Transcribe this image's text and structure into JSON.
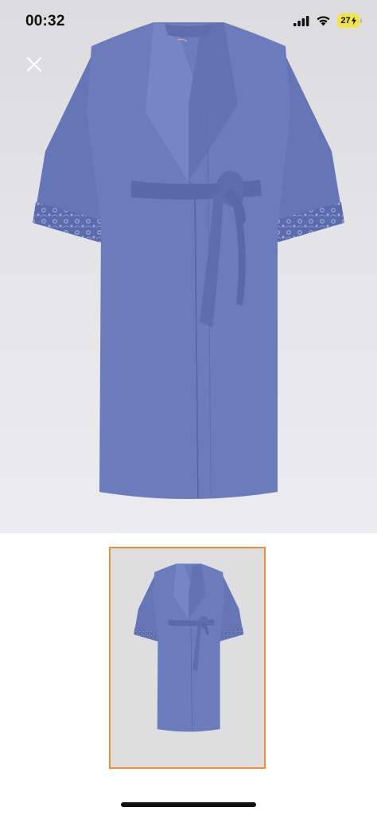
{
  "status_bar": {
    "time": "00:32",
    "battery_level": "27",
    "signal_icon": "cellular-signal-icon",
    "wifi_icon": "wifi-icon",
    "battery_charging": true
  },
  "viewer": {
    "close_icon": "close-icon",
    "main_image": "blue-kimono-robe-front",
    "thumbnails": [
      {
        "image": "blue-kimono-robe-front",
        "selected": true
      }
    ],
    "selection_color": "#f08c3c",
    "robe_color": "#6a7cbd"
  }
}
